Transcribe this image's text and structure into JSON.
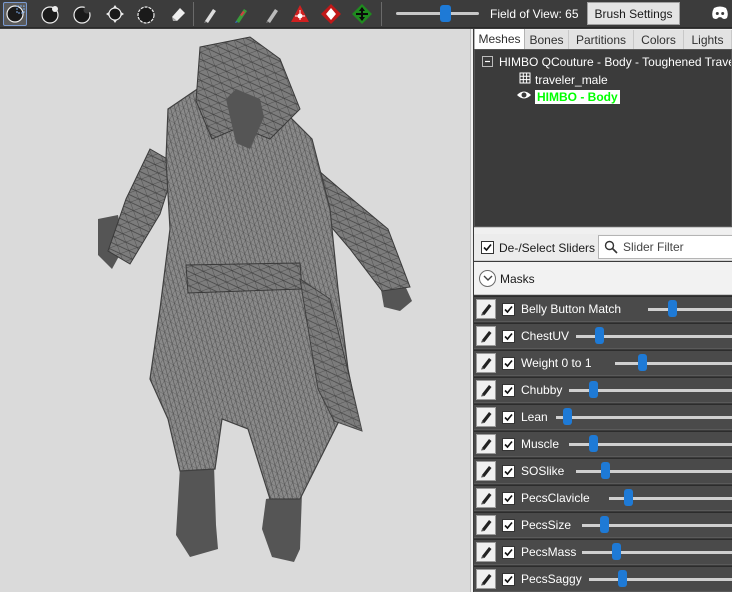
{
  "toolbar": {
    "tools": [
      {
        "icon": "select-brush-icon",
        "active": true
      },
      {
        "icon": "inflate-brush-icon"
      },
      {
        "icon": "deflate-brush-icon"
      },
      {
        "icon": "move-brush-icon"
      },
      {
        "icon": "smooth-brush-icon"
      },
      {
        "icon": "eraser-icon"
      },
      {
        "icon": "weight-brush-icon"
      },
      {
        "icon": "color-brush-icon"
      },
      {
        "icon": "alpha-brush-icon"
      },
      {
        "icon": "translate-gizmo-icon"
      },
      {
        "icon": "rotate-gizmo-icon"
      },
      {
        "icon": "scale-gizmo-icon"
      }
    ],
    "fov_label": "Field of View: 65",
    "fov_value": 65,
    "brush_settings_label": "Brush Settings",
    "discord_icon": "discord-icon"
  },
  "tabs": [
    {
      "label": "Meshes",
      "active": true
    },
    {
      "label": "Bones"
    },
    {
      "label": "Partitions"
    },
    {
      "label": "Colors"
    },
    {
      "label": "Lights"
    }
  ],
  "tree": {
    "root": "HIMBO QCouture - Body - Toughened Traveler",
    "children": [
      {
        "label": "traveler_male",
        "icon": "mesh-grid-icon",
        "selected": false
      },
      {
        "label": "HIMBO - Body",
        "icon": "eye-icon",
        "selected": true
      }
    ]
  },
  "slider_header": {
    "deselect_label": "De-/Select Sliders",
    "deselect_checked": true,
    "filter_placeholder": "Slider Filter"
  },
  "masks_label": "Masks",
  "sliders": [
    {
      "label": "Belly Button Match",
      "checked": true,
      "value": 0.06
    },
    {
      "label": "ChestUV",
      "checked": true,
      "value": 0.03
    },
    {
      "label": "Weight 0 to 1",
      "checked": true,
      "value": 0.05
    },
    {
      "label": "Chubby",
      "checked": true,
      "value": 0.03
    },
    {
      "label": "Lean",
      "checked": true,
      "value": 0.01
    },
    {
      "label": "Muscle",
      "checked": true,
      "value": 0.03
    },
    {
      "label": "SOSlike",
      "checked": true,
      "value": 0.04
    },
    {
      "label": "PecsClavicle",
      "checked": true,
      "value": 0.03
    },
    {
      "label": "PecsSize",
      "checked": true,
      "value": 0.03
    },
    {
      "label": "PecsMass",
      "checked": true,
      "value": 0.05
    },
    {
      "label": "PecsSaggy",
      "checked": true,
      "value": 0.05
    }
  ],
  "colors": {
    "accent": "#1e7ad6",
    "selected_text": "#00ff00",
    "panel_dark": "#3b3b3b"
  }
}
